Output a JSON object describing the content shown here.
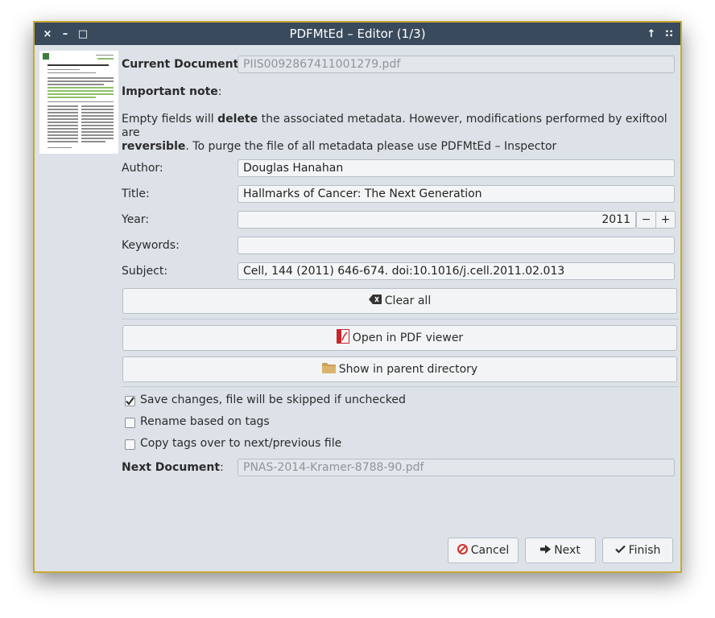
{
  "window": {
    "title": "PDFMtEd – Editor (1/3)"
  },
  "titlebar": {
    "close_glyph": "×",
    "minimize_glyph": "–",
    "maximize_glyph": "□",
    "up_glyph": "↑",
    "grid_glyph": "∷"
  },
  "current_document": {
    "label_bold": "Current Document",
    "label_suffix": ":",
    "value": "PIIS0092867411001279.pdf"
  },
  "note": {
    "heading_bold": "Important note",
    "heading_suffix": ":",
    "line1_a": "Empty fields will ",
    "line1_bold": "delete",
    "line1_b": " the associated metadata. However, modifications performed by exiftool are",
    "line2_bold": "reversible",
    "line2_b": ". To purge the file of all metadata please use PDFMtEd – Inspector"
  },
  "fields": {
    "author": {
      "label": "Author:",
      "value": "Douglas Hanahan"
    },
    "title": {
      "label": "Title:",
      "value": "Hallmarks of Cancer: The Next Generation"
    },
    "year": {
      "label": "Year:",
      "value": "2011",
      "minus": "−",
      "plus": "+"
    },
    "keywords": {
      "label": "Keywords:",
      "value": ""
    },
    "subject": {
      "label": "Subject:",
      "value": "Cell, 144 (2011) 646-674. doi:10.1016/j.cell.2011.02.013"
    }
  },
  "buttons": {
    "clear_all": {
      "icon": "backspace-icon",
      "text": "Clear all"
    },
    "open_pdf": {
      "icon": "pdf-icon",
      "text": "Open in PDF viewer"
    },
    "show_dir": {
      "icon": "folder-icon",
      "text": "Show in parent directory"
    }
  },
  "checkboxes": {
    "save_changes": {
      "text": "Save changes, file will be skipped if unchecked",
      "checked": true
    },
    "rename": {
      "text": "Rename based on tags",
      "checked": false
    },
    "copy_tags": {
      "text": "Copy tags over to next/previous file",
      "checked": false
    }
  },
  "next_document": {
    "label_bold": "Next Document",
    "label_suffix": ":",
    "value": "PNAS-2014-Kramer-8788-90.pdf"
  },
  "actions": {
    "cancel": "Cancel",
    "next": "Next",
    "finish": "Finish"
  },
  "colors": {
    "titlebar": "#3a4a5d",
    "window_border": "#c9a92e",
    "client_bg": "#dde2e8",
    "cancel_icon": "#d0342c",
    "pdf_icon": "#c6262e",
    "folder_icon": "#c9a05a"
  }
}
